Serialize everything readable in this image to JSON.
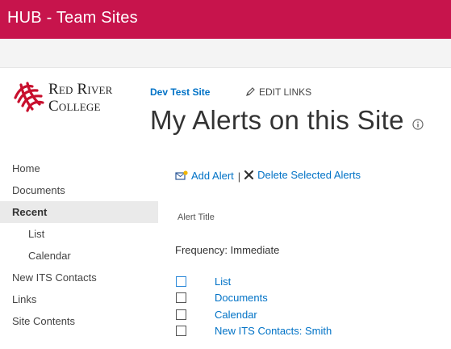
{
  "suite_bar": {
    "title": "HUB - Team Sites",
    "color": "#c7144c"
  },
  "logo": {
    "line1": "Red River",
    "line2": "College"
  },
  "header": {
    "site_link": "Dev Test Site",
    "edit_links": "EDIT LINKS",
    "page_title": "My Alerts on this Site"
  },
  "quick_launch": {
    "items": [
      {
        "label": "Home"
      },
      {
        "label": "Documents"
      },
      {
        "label": "Recent",
        "selected": true
      },
      {
        "label": "List"
      },
      {
        "label": "Calendar"
      },
      {
        "label": "New ITS Contacts"
      },
      {
        "label": "Links"
      },
      {
        "label": "Site Contents"
      }
    ]
  },
  "toolbar": {
    "add_alert": "Add Alert",
    "separator": "|",
    "delete_alerts": "Delete Selected Alerts"
  },
  "table": {
    "column_header": "Alert Title",
    "group_label": "Frequency: Immediate",
    "alerts": [
      {
        "title": "List",
        "checked": false
      },
      {
        "title": "Documents",
        "checked": false
      },
      {
        "title": "Calendar",
        "checked": false
      },
      {
        "title": "New ITS Contacts: Smith",
        "checked": false
      }
    ]
  },
  "colors": {
    "link": "#0072c6",
    "brand": "#c7144c",
    "logo_mark": "#c8102e"
  },
  "icons": {
    "edit": "pencil-icon",
    "info": "info-icon",
    "add_alert": "add-alert-icon",
    "delete": "delete-x-icon"
  }
}
